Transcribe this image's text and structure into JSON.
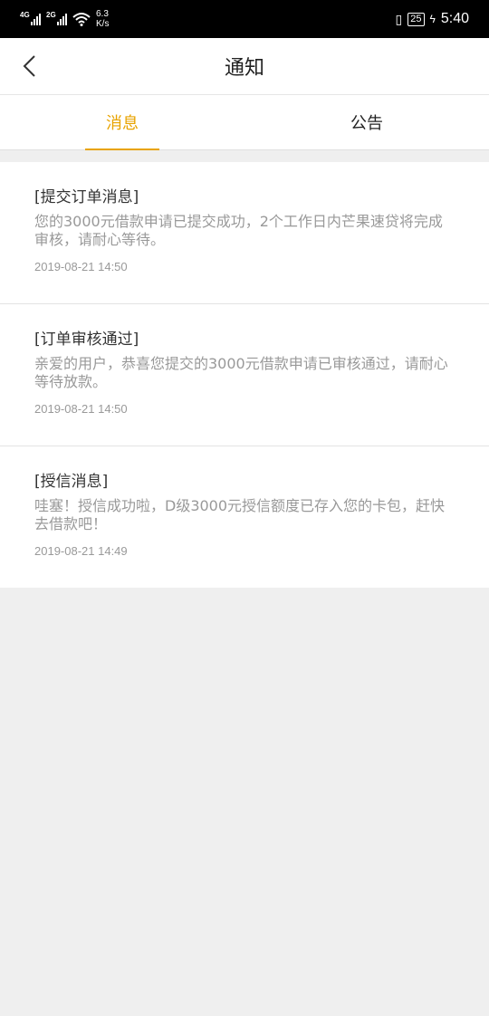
{
  "status_bar": {
    "network1": "4G",
    "network2": "2G",
    "speed_value": "6.3",
    "speed_unit": "K/s",
    "battery": "25",
    "time": "5:40"
  },
  "header": {
    "title": "通知"
  },
  "tabs": [
    {
      "label": "消息",
      "active": true
    },
    {
      "label": "公告",
      "active": false
    }
  ],
  "messages": [
    {
      "title": "[提交订单消息]",
      "body": "您的3000元借款申请已提交成功，2个工作日内芒果速贷将完成审核，请耐心等待。",
      "time": "2019-08-21 14:50"
    },
    {
      "title": "[订单审核通过]",
      "body": "亲爱的用户，恭喜您提交的3000元借款申请已审核通过，请耐心等待放款。",
      "time": "2019-08-21 14:50"
    },
    {
      "title": "[授信消息]",
      "body": "哇塞！授信成功啦，D级3000元授信额度已存入您的卡包，赶快去借款吧！",
      "time": "2019-08-21 14:49"
    }
  ],
  "colors": {
    "accent": "#e8a300",
    "background": "#efefef",
    "secondary_text": "#999999"
  }
}
